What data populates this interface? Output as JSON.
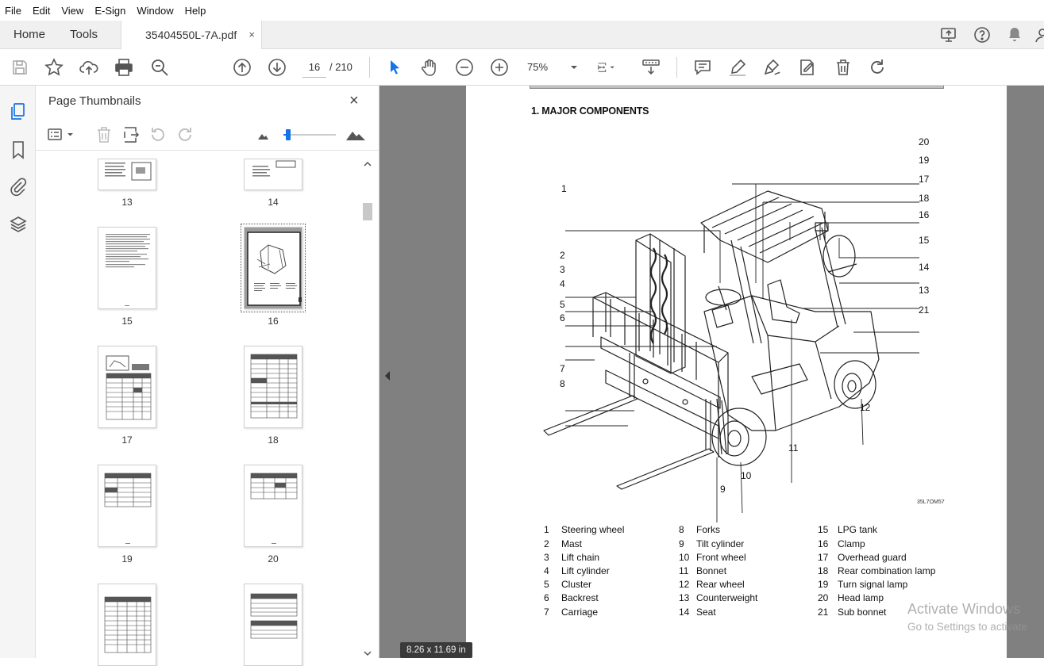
{
  "menu": [
    "File",
    "Edit",
    "View",
    "E-Sign",
    "Window",
    "Help"
  ],
  "tabs": {
    "home": "Home",
    "tools": "Tools",
    "document": "35404550L-7A.pdf",
    "close": "×"
  },
  "toolbar": {
    "page_current": "16",
    "page_total": "/  210",
    "zoom": "75%"
  },
  "panel": {
    "title": "Page Thumbnails",
    "close": "×",
    "thumbnails": [
      {
        "label": "13"
      },
      {
        "label": "14"
      },
      {
        "label": "15"
      },
      {
        "label": "16",
        "selected": true
      },
      {
        "label": "17"
      },
      {
        "label": "18"
      },
      {
        "label": "19"
      },
      {
        "label": "20"
      },
      {
        "label": ""
      },
      {
        "label": ""
      }
    ]
  },
  "document": {
    "heading": "1. MAJOR COMPONENTS",
    "figure_code": "35L7OM57",
    "callouts": [
      "1",
      "2",
      "3",
      "4",
      "5",
      "6",
      "7",
      "8",
      "9",
      "10",
      "11",
      "12",
      "13",
      "14",
      "15",
      "16",
      "17",
      "18",
      "19",
      "20",
      "21"
    ],
    "legend": [
      {
        "n": "1",
        "name": "Steering wheel"
      },
      {
        "n": "2",
        "name": "Mast"
      },
      {
        "n": "3",
        "name": "Lift chain"
      },
      {
        "n": "4",
        "name": "Lift cylinder"
      },
      {
        "n": "5",
        "name": "Cluster"
      },
      {
        "n": "6",
        "name": "Backrest"
      },
      {
        "n": "7",
        "name": "Carriage"
      },
      {
        "n": "8",
        "name": "Forks"
      },
      {
        "n": "9",
        "name": "Tilt cylinder"
      },
      {
        "n": "10",
        "name": "Front wheel"
      },
      {
        "n": "11",
        "name": "Bonnet"
      },
      {
        "n": "12",
        "name": "Rear wheel"
      },
      {
        "n": "13",
        "name": "Counterweight"
      },
      {
        "n": "14",
        "name": "Seat"
      },
      {
        "n": "15",
        "name": "LPG tank"
      },
      {
        "n": "16",
        "name": "Clamp"
      },
      {
        "n": "17",
        "name": "Overhead guard"
      },
      {
        "n": "18",
        "name": "Rear combination lamp"
      },
      {
        "n": "19",
        "name": "Turn signal lamp"
      },
      {
        "n": "20",
        "name": "Head lamp"
      },
      {
        "n": "21",
        "name": "Sub bonnet"
      }
    ],
    "page_size": "8.26 x 11.69 in"
  },
  "watermark": {
    "line1": "Activate Windows",
    "line2": "Go to Settings to activate"
  },
  "colors": {
    "accent": "#1473e6",
    "doc_bg": "#808080"
  }
}
